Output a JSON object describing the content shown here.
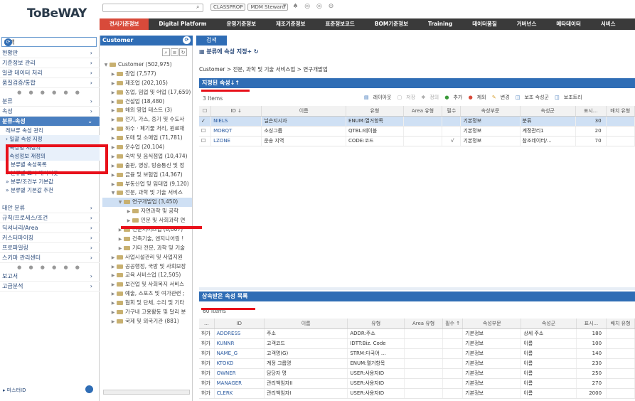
{
  "app": {
    "logo": "ToBeWAY"
  },
  "topbar": {
    "chips": [
      "CLASSPROP",
      "MDM Steward"
    ],
    "icons": "▾ ♠ ◎ ◎ ⊖"
  },
  "mainnav": [
    "전사기준정보",
    "Digital Platform",
    "운영기준정보",
    "제조기준정보",
    "표준정보코드",
    "BOM기준정보",
    "Training",
    "데이터품질",
    "거버넌스",
    "메타데이터",
    "서비스"
  ],
  "left": {
    "select": "고객",
    "menu_a": [
      "현황판",
      "기준정보 관리",
      "일괄 데이터 처리",
      "품질검증/통합"
    ],
    "menu_b": [
      "분류",
      "속성"
    ],
    "menu_sel": "분류-속성",
    "menu_sel_hidden": "레브류 속성 관리",
    "subs": [
      "일괄 속성 지정",
      "속성명 재정의",
      "속성정보 재정의"
    ],
    "subs2": [
      "분류별 속성목록",
      "분류별 표시 레이아웃",
      "분류/조건부 기본값",
      "분류별 기본값 추천"
    ],
    "menu_c": [
      "대안 분류",
      "규칙/프로세스/조건",
      "딕셔너리/Area",
      "커스터마이징",
      "프로파일링",
      "스키마 관리센터"
    ],
    "menu_d": [
      "보고서",
      "고급분석"
    ],
    "bottom": "▸ 마스터ID"
  },
  "tree": {
    "header": "Customer",
    "root": "Customer (502,975)",
    "nodes": [
      "광업 (7,577)",
      "제조업 (202,105)",
      "농업, 임업 및 어업 (17,659)",
      "건설업 (18,480)",
      "해외 영업 테스트 (3)",
      "전기, 가스, 증기 및 수도사",
      "하수 · 폐기물 처리, 원료재",
      "도매 및 소매업 (71,781)",
      "운수업 (20,104)",
      "숙박 및 음식점업 (10,474)",
      "출판, 영상, 방송통신 및 정",
      "금융 및 보험업 (14,367)",
      "부동산업 및 임대업 (9,120)",
      "전문, 과학 및 기술 서비스"
    ],
    "selected": "연구개발업 (3,450)",
    "hidden": "자연과학 및 공학",
    "children": [
      "인문 및 사회과학 연",
      "전문서비스업 (8,007)",
      "건축기술, 엔지니어링 !",
      "기타 전문, 과학 및 기술"
    ],
    "nodes2": [
      "사업시설관리 및 사업지원",
      "공공행정, 국방 및 사회보장",
      "교육 서비스업 (12,505)",
      "보건업 및 사회복지 서비스",
      "예술, 스포츠 및 여가관련 ;",
      "협회 및 단체, 수리 및 기타",
      "가구내 고용활동 및 달리 분",
      "국제 및 외국기관 (881)"
    ]
  },
  "content": {
    "tab": "검색",
    "title": "분류에 속성 지정+",
    "path": "Customer > 전문, 과학 및 기술 서비스업 > 연구개발업",
    "assigned_header": "지정된 속성↓↑",
    "assigned_count": "3 Items",
    "toolbar": [
      "레이아웃",
      "저장",
      "정의",
      "추가",
      "제외",
      "변경",
      "보조 속성군",
      "보조트리"
    ],
    "cols": [
      "ID ↓",
      "이름",
      "유형",
      "Area 유형",
      "필수",
      "속성부문",
      "속성군",
      "표시...",
      "배치 유형"
    ],
    "rows": [
      {
        "id": "NIELS",
        "name": "닐슨지시자",
        "type": "ENUM:열거항목",
        "area": "",
        "req": "",
        "part": "기본정보",
        "grp": "분류",
        "disp": "30"
      },
      {
        "id": "MOBQT",
        "name": "소싱그룹",
        "type": "QTBL:테이블",
        "area": "",
        "req": "",
        "part": "기본정보",
        "grp": "계정관리1",
        "disp": "20"
      },
      {
        "id": "LZONE",
        "name": "운송 지역",
        "type": "CODE:코드",
        "area": "",
        "req": "√",
        "part": "기본정보",
        "grp": "참조데이터/...",
        "disp": "70"
      }
    ],
    "inherit_header": "상속받은 속성 목록",
    "inherit_count": "60 Items",
    "cols2": [
      "...",
      "ID",
      "이름",
      "유형",
      "Area 유형",
      "필수 ↑",
      "속성부문",
      "속성군",
      "표시...",
      "배치 유형"
    ],
    "rows2": [
      {
        "a": "허가",
        "id": "ADDRESS",
        "name": "주소",
        "type": "ADDR:주소",
        "part": "기본정보",
        "grp": "상세 주소",
        "disp": "180"
      },
      {
        "a": "허가",
        "id": "KUNNR",
        "name": "고객코드",
        "type": "IDTT:Biz. Code",
        "part": "기본정보",
        "grp": "이름",
        "disp": "100"
      },
      {
        "a": "허가",
        "id": "NAME_G",
        "name": "고객명(G)",
        "type": "STRM:다국어 ...",
        "part": "기본정보",
        "grp": "이름",
        "disp": "140"
      },
      {
        "a": "허가",
        "id": "KTOKD",
        "name": "계정 그룹명",
        "type": "ENUM:열거항목",
        "part": "기본정보",
        "grp": "이름",
        "disp": "230"
      },
      {
        "a": "허가",
        "id": "OWNER",
        "name": "담당자 명",
        "type": "USER:사용자ID",
        "part": "기본정보",
        "grp": "이름",
        "disp": "250"
      },
      {
        "a": "허가",
        "id": "MANAGER",
        "name": "관리책임자II",
        "type": "USER:사용자ID",
        "part": "기본정보",
        "grp": "이름",
        "disp": "270"
      },
      {
        "a": "허가",
        "id": "CLERK",
        "name": "관리책임자I",
        "type": "USER:사용자ID",
        "part": "기본정보",
        "grp": "이름",
        "disp": "2000"
      }
    ]
  },
  "colors": {
    "accent": "#2f6db5",
    "nav_active": "#d84a3a",
    "highlight": "#e8101a"
  }
}
